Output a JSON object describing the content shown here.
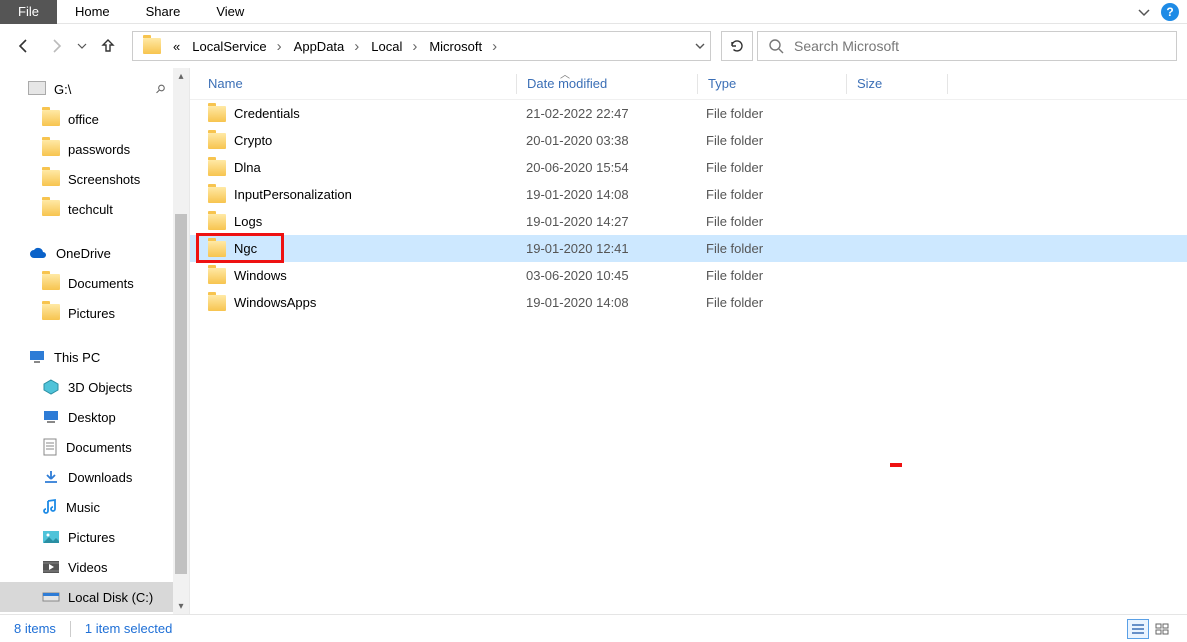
{
  "ribbon": {
    "tabs": [
      "File",
      "Home",
      "Share",
      "View"
    ],
    "active_index": 0
  },
  "breadcrumb": {
    "prefix": "«",
    "segments": [
      "LocalService",
      "AppData",
      "Local",
      "Microsoft"
    ]
  },
  "search": {
    "placeholder": "Search Microsoft"
  },
  "tree": {
    "items": [
      {
        "label": "G:\\",
        "icon": "drive",
        "pinned": true,
        "level": 1
      },
      {
        "label": "office",
        "icon": "folder",
        "level": 2
      },
      {
        "label": "passwords",
        "icon": "folder",
        "level": 2
      },
      {
        "label": "Screenshots",
        "icon": "folder",
        "level": 2
      },
      {
        "label": "techcult",
        "icon": "folder",
        "level": 2
      },
      {
        "label": "OneDrive",
        "icon": "cloud",
        "level": 1
      },
      {
        "label": "Documents",
        "icon": "folder",
        "level": 2
      },
      {
        "label": "Pictures",
        "icon": "folder",
        "level": 2
      },
      {
        "label": "This PC",
        "icon": "pc",
        "level": 1
      },
      {
        "label": "3D Objects",
        "icon": "3d",
        "level": 2
      },
      {
        "label": "Desktop",
        "icon": "desktop",
        "level": 2
      },
      {
        "label": "Documents",
        "icon": "docs",
        "level": 2
      },
      {
        "label": "Downloads",
        "icon": "downloads",
        "level": 2
      },
      {
        "label": "Music",
        "icon": "music",
        "level": 2
      },
      {
        "label": "Pictures",
        "icon": "pictures",
        "level": 2
      },
      {
        "label": "Videos",
        "icon": "videos",
        "level": 2
      },
      {
        "label": "Local Disk (C:)",
        "icon": "localdisk",
        "level": 2,
        "selected": true
      }
    ]
  },
  "columns": {
    "name": "Name",
    "date": "Date modified",
    "type": "Type",
    "size": "Size"
  },
  "rows": [
    {
      "name": "Credentials",
      "date": "21-02-2022 22:47",
      "type": "File folder"
    },
    {
      "name": "Crypto",
      "date": "20-01-2020 03:38",
      "type": "File folder"
    },
    {
      "name": "Dlna",
      "date": "20-06-2020 15:54",
      "type": "File folder"
    },
    {
      "name": "InputPersonalization",
      "date": "19-01-2020 14:08",
      "type": "File folder"
    },
    {
      "name": "Logs",
      "date": "19-01-2020 14:27",
      "type": "File folder"
    },
    {
      "name": "Ngc",
      "date": "19-01-2020 12:41",
      "type": "File folder",
      "selected": true,
      "highlighted": true
    },
    {
      "name": "Windows",
      "date": "03-06-2020 10:45",
      "type": "File folder"
    },
    {
      "name": "WindowsApps",
      "date": "19-01-2020 14:08",
      "type": "File folder"
    }
  ],
  "status": {
    "count": "8 items",
    "selection": "1 item selected"
  }
}
